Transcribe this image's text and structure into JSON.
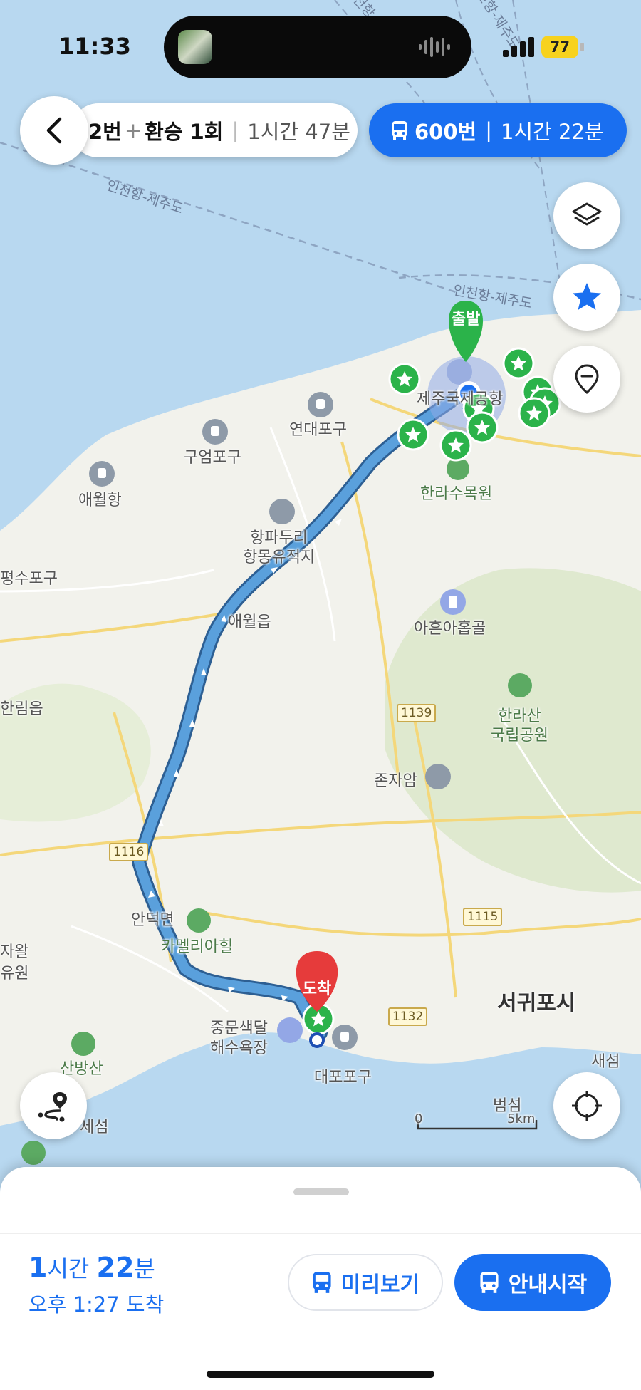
{
  "status_bar": {
    "time": "11:33",
    "battery": "77"
  },
  "header": {
    "back_icon": "chevron-left-icon",
    "routes": [
      {
        "bus": "2번",
        "plus": "+",
        "transfer": "환승 1회",
        "time": "1시간 47분"
      },
      {
        "bus": "600번",
        "time": "1시간 22분",
        "icon": "bus-icon"
      }
    ]
  },
  "map": {
    "sea_labels": [
      "인천항-제주도",
      "인천항-제주도",
      "인천항-제주도",
      "인천항-제주도"
    ],
    "places": {
      "airport": "제주국제공항",
      "yeondae": "연대포구",
      "gueom": "구엄포구",
      "aewol_port": "애월항",
      "hangpa_1": "항파두리",
      "hangpa_2": "항몽유적지",
      "aewol": "애월읍",
      "arboretum": "한라수목원",
      "aheun": "아흔아홉골",
      "hallasan_1": "한라산",
      "hallasan_2": "국립공원",
      "jonja": "존자암",
      "hallim": "한림읍",
      "pyeongsu": "평수포구",
      "andeok": "안덕면",
      "camellia": "카멜리아힐",
      "seogwipo": "서귀포시",
      "jungmun_1": "중문색달",
      "jungmun_2": "해수욕장",
      "daepo": "대포포구",
      "sanbang": "산방산",
      "beomseom": "범섬",
      "saeseom": "새섬",
      "hwasun": "세섬",
      "jawal": "자왈",
      "yuwon": "유원"
    },
    "roads": [
      "1139",
      "1116",
      "1115",
      "1132"
    ],
    "start_label": "출발",
    "end_label": "도착",
    "scale": {
      "zero": "0",
      "distance": "5km"
    }
  },
  "side_buttons": [
    "layers-icon",
    "star-icon",
    "location-pin-icon"
  ],
  "bottom_buttons": [
    "route-pin-icon",
    "crosshair-icon"
  ],
  "sheet": {
    "dur_h": "1",
    "dur_h_unit": "시간 ",
    "dur_m": "22",
    "dur_m_unit": "분",
    "arrival": "오후 1:27 도착",
    "preview_label": "미리보기",
    "start_label": "안내시작"
  },
  "colors": {
    "accent": "#1a6ff0",
    "route": "#4a8ed0",
    "start_pin": "#2bb34a",
    "end_pin": "#e63b3b",
    "sea": "#b8d8f0"
  }
}
